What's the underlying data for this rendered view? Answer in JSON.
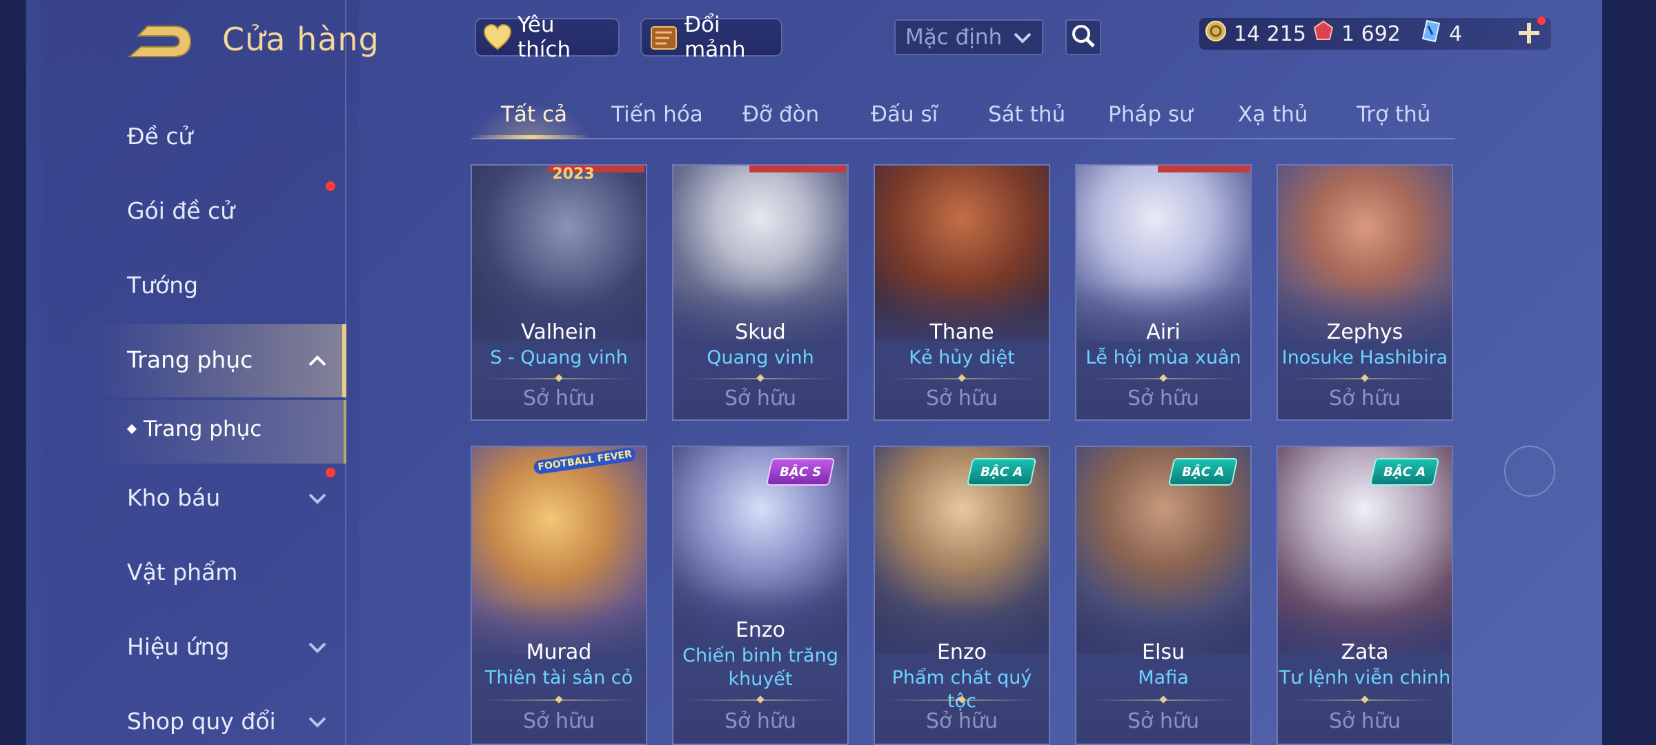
{
  "header": {
    "title": "Cửa hàng",
    "favorites_label": "Yêu thích",
    "exchange_label": "Đổi mảnh",
    "sort_select": "Mặc định"
  },
  "currency": {
    "gold": "14 215",
    "voucher": "1 692",
    "shards": "4"
  },
  "sidebar": {
    "items": [
      {
        "label": "Đề cử"
      },
      {
        "label": "Gói đề cử"
      },
      {
        "label": "Tướng"
      },
      {
        "label": "Trang phục"
      },
      {
        "label": "Kho báu"
      },
      {
        "label": "Vật phẩm"
      },
      {
        "label": "Hiệu ứng"
      },
      {
        "label": "Shop quy đổi"
      }
    ],
    "sub_item": "Trang phục"
  },
  "tabs": [
    "Tất cả",
    "Tiến hóa",
    "Đỡ đòn",
    "Đấu sĩ",
    "Sát thủ",
    "Pháp sư",
    "Xạ thủ",
    "Trợ thủ"
  ],
  "cards": [
    {
      "hero": "Valhein",
      "skin": "S - Quang vinh",
      "status": "Sở hữu",
      "tag": "2023"
    },
    {
      "hero": "Skud",
      "skin": "Quang vinh",
      "status": "Sở hữu"
    },
    {
      "hero": "Thane",
      "skin": "Kẻ hủy diệt",
      "status": "Sở hữu"
    },
    {
      "hero": "Airi",
      "skin": "Lễ hội mùa xuân",
      "status": "Sở hữu"
    },
    {
      "hero": "Zephys",
      "skin": "Inosuke Hashibira",
      "status": "Sở hữu"
    },
    {
      "hero": "Murad",
      "skin": "Thiên tài sân cỏ",
      "status": "Sở hữu",
      "tag": "FOOTBALL FEVER"
    },
    {
      "hero": "Enzo",
      "skin": "Chiến binh trăng khuyết",
      "status": "Sở hữu",
      "badge": "BẬC S"
    },
    {
      "hero": "Enzo",
      "skin": "Phẩm chất quý tộc",
      "status": "Sở hữu",
      "badge": "BẬC A"
    },
    {
      "hero": "Elsu",
      "skin": "Mafia",
      "status": "Sở hữu",
      "badge": "BẬC A"
    },
    {
      "hero": "Zata",
      "skin": "Tư lệnh viễn chinh",
      "status": "Sở hữu",
      "badge": "BẬC A"
    }
  ],
  "colors": {
    "accent_gold": "#e9cd8a",
    "skin_text": "#6ed3ff",
    "notification_dot": "#ff3b3b"
  }
}
